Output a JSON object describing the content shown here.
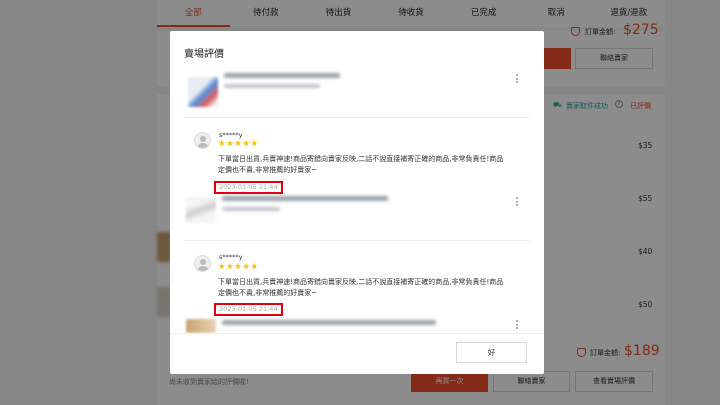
{
  "tabs": [
    "全部",
    "待付款",
    "待出貨",
    "待收貨",
    "已完成",
    "取消",
    "退貨/退款"
  ],
  "orders": {
    "top_total_label": "訂單金額:",
    "top_total_amount": "$275",
    "contact_seller_label": "聯絡賣家",
    "shipping_status": "賣家取件成功",
    "status_done": "已評價",
    "item_prices": [
      "$35",
      "$55",
      "$40",
      "$50"
    ],
    "bottom_total_label": "訂單金額:",
    "bottom_total_amount": "$189",
    "footer_note": "尚未收到賣家給的評價喔!",
    "buy_again_label": "再買一次",
    "contact_seller_label_2": "聯絡賣家",
    "view_seller_rating_label": "查看賣場評價"
  },
  "modal": {
    "title": "賣場評價",
    "reviews": [
      {
        "username": "s*****y",
        "stars": "★★★★★",
        "text": "下單當日出貨,兵賣神速!商品寄錯向賣家反映,二話不說直接補寄正確的商品,非常負責任!商品定價也不貴,非常推薦的好賣家~",
        "date": "2023-01-05 21:44"
      },
      {
        "username": "s*****y",
        "stars": "★★★★★",
        "text": "下單當日出貨,兵賣神速!商品寄錯向賣家反映,二話不說直接補寄正確的商品,非常負責任!商品定價也不貴,非常推薦的好賣家~",
        "date": "2023-01-05 21:44"
      }
    ],
    "ok_label": "好"
  },
  "colors": {
    "accent": "#ee4d2d",
    "green": "#26aa99",
    "star": "#ffbf00",
    "highlight": "#e0000f"
  },
  "icons": [
    "shield-icon",
    "truck-icon",
    "help-icon",
    "user-avatar-icon",
    "kebab-menu-icon"
  ]
}
